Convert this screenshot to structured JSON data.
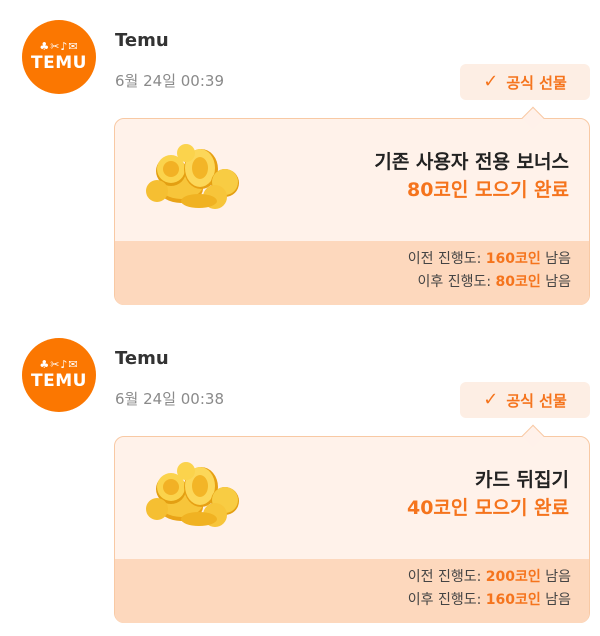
{
  "messages": [
    {
      "avatar": {
        "brand": "TEMU",
        "glyphs": "♣✂♪✉"
      },
      "sender": "Temu",
      "time": "6월 24일 00:39",
      "badge": {
        "label": "공식 선물"
      },
      "card": {
        "title": "기존 사용자 전용 보너스",
        "subtitle": "80코인 모으기 완료",
        "before": {
          "label": "이전 진행도:",
          "value": "160코인",
          "suffix": "남음"
        },
        "after": {
          "label": "이후 진행도:",
          "value": "80코인",
          "suffix": "남음"
        }
      }
    },
    {
      "avatar": {
        "brand": "TEMU",
        "glyphs": "♣✂♪✉"
      },
      "sender": "Temu",
      "time": "6월 24일 00:38",
      "badge": {
        "label": "공식 선물"
      },
      "card": {
        "title": "카드 뒤집기",
        "subtitle": "40코인 모으기 완료",
        "before": {
          "label": "이전 진행도:",
          "value": "200코인",
          "suffix": "남음"
        },
        "after": {
          "label": "이후 진행도:",
          "value": "160코인",
          "suffix": "남음"
        }
      }
    }
  ],
  "colors": {
    "brand": "#fb7701",
    "accent": "#f5741d",
    "card_bg": "#fff1ea",
    "card_footer": "#fdd8bd"
  },
  "icons": {
    "check": "check-icon",
    "coins": "gold-coins-icon"
  }
}
